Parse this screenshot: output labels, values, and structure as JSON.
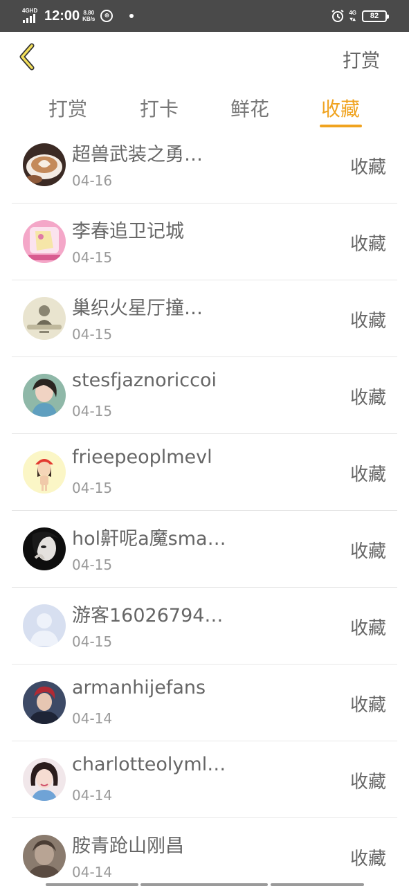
{
  "status_bar": {
    "network": "4GHD",
    "time": "12:00",
    "speed_value": "8.80",
    "speed_unit": "KB/s",
    "network_right": "4G",
    "battery": "82"
  },
  "header": {
    "back_icon": "chevron-left-icon",
    "action_label": "打赏",
    "accent_color": "#f0a31f"
  },
  "tabs": [
    {
      "label": "打赏",
      "active": false
    },
    {
      "label": "打卡",
      "active": false
    },
    {
      "label": "鲜花",
      "active": false
    },
    {
      "label": "收藏",
      "active": true
    }
  ],
  "list": {
    "items": [
      {
        "name": "超兽武装之勇…",
        "date": "04-16",
        "action": "收藏"
      },
      {
        "name": "李春追卫记城",
        "date": "04-15",
        "action": "收藏"
      },
      {
        "name": "巢织火星厅撞…",
        "date": "04-15",
        "action": "收藏"
      },
      {
        "name": "stesfjaznoriccoi",
        "date": "04-15",
        "action": "收藏"
      },
      {
        "name": "frieepeoplmevl",
        "date": "04-15",
        "action": "收藏"
      },
      {
        "name": "hol鼾呢a魔sma…",
        "date": "04-15",
        "action": "收藏"
      },
      {
        "name": "游客16026794…",
        "date": "04-15",
        "action": "收藏"
      },
      {
        "name": "armanhijefans",
        "date": "04-14",
        "action": "收藏"
      },
      {
        "name": "charlotteolyml…",
        "date": "04-14",
        "action": "收藏"
      },
      {
        "name": "胺青跄山刚昌",
        "date": "04-14",
        "action": "收藏"
      }
    ]
  }
}
